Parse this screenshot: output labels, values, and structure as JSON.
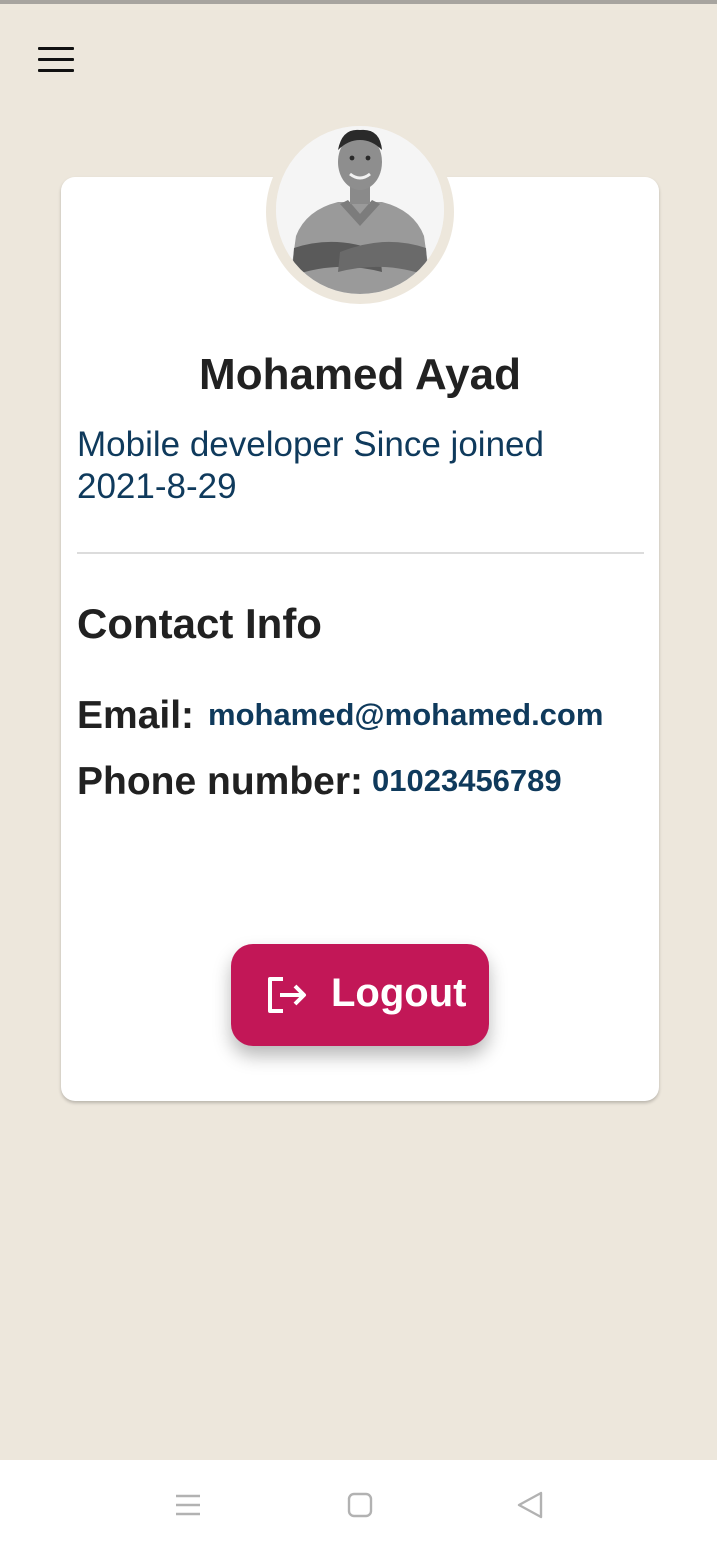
{
  "header": {
    "menu_icon": "hamburger-menu-icon"
  },
  "profile": {
    "name": "Mohamed Ayad",
    "subtitle": "Mobile developer Since joined 2021-8-29"
  },
  "contact": {
    "title": "Contact Info",
    "email_label": "Email:",
    "email_value": "mohamed@mohamed.com",
    "phone_label": "Phone number:",
    "phone_value": "01023456789"
  },
  "logout": {
    "label": "Logout",
    "icon": "logout-icon"
  },
  "navbar": {
    "recents_icon": "recents-icon",
    "home_icon": "home-square-icon",
    "back_icon": "back-triangle-icon"
  },
  "colors": {
    "background": "#ede7dc",
    "accent": "#c21757",
    "link_text": "#0f3a5c"
  }
}
